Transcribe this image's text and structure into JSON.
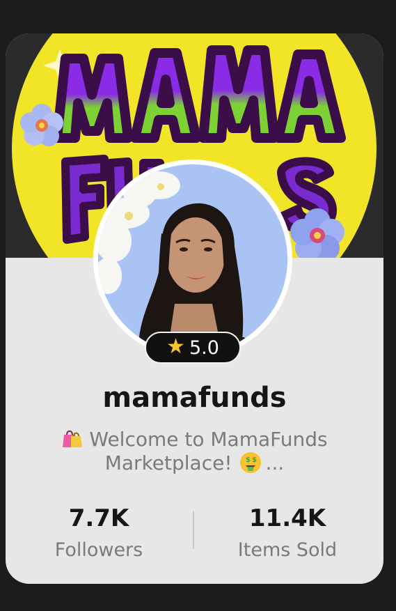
{
  "profile": {
    "username": "mamafunds",
    "rating": "5.0",
    "bio_line1": "Welcome to MamaFunds",
    "bio_line2": "Marketplace!",
    "bio_ellipsis": "...",
    "banner_logo_text": "MAMA FUNDS"
  },
  "stats": {
    "followers_value": "7.7K",
    "followers_label": "Followers",
    "items_sold_value": "11.4K",
    "items_sold_label": "Items Sold"
  },
  "icons": {
    "rating": "star-icon",
    "bio_start": "shopping-bags-emoji",
    "bio_end": "money-mouth-face-emoji"
  },
  "colors": {
    "background": "#1c1c1e",
    "card": "#e7e7e8",
    "primary_text": "#151515",
    "secondary_text": "#7a7a7d",
    "banner_yellow": "#f2e528",
    "banner_purple": "#7a2bd0",
    "banner_green": "#7ed332",
    "star": "#f7c52a"
  }
}
